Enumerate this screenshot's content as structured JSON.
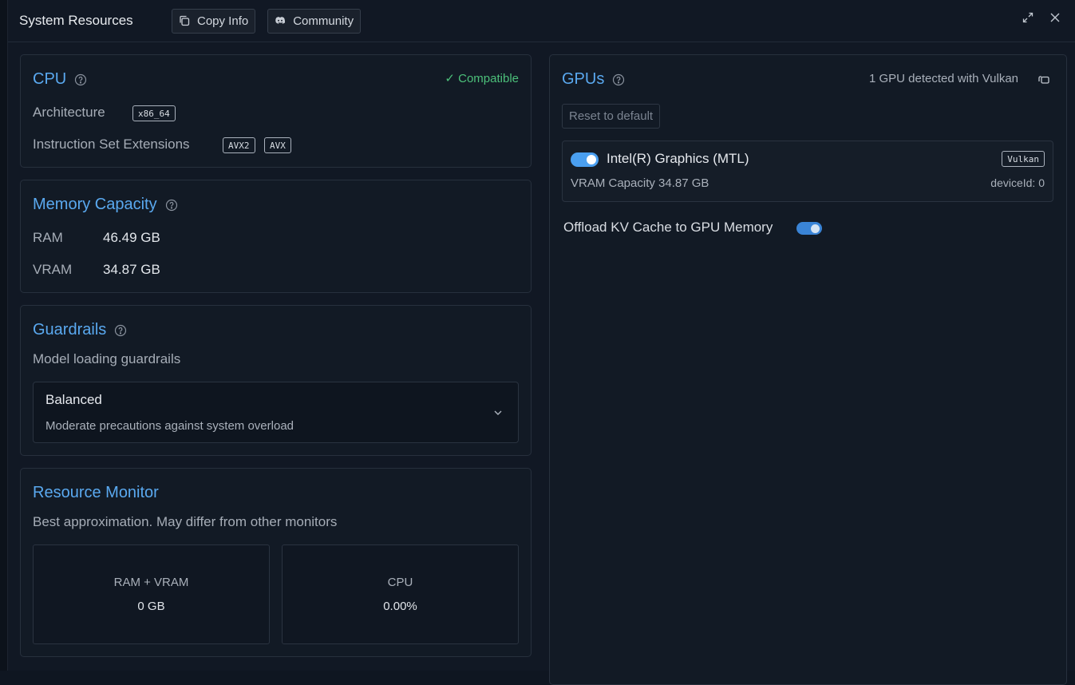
{
  "window": {
    "title": "System Resources",
    "copy_info_label": "Copy Info",
    "community_label": "Community"
  },
  "cpu": {
    "title": "CPU",
    "status": "✓ Compatible",
    "architecture_label": "Architecture",
    "architecture_value": "x86_64",
    "extensions_label": "Instruction Set Extensions",
    "extensions": [
      "AVX2",
      "AVX"
    ]
  },
  "memory": {
    "title": "Memory Capacity",
    "ram_label": "RAM",
    "ram_value": "46.49 GB",
    "vram_label": "VRAM",
    "vram_value": "34.87 GB"
  },
  "guardrails": {
    "title": "Guardrails",
    "subtitle": "Model loading guardrails",
    "selected": "Balanced",
    "selected_desc": "Moderate precautions against system overload"
  },
  "monitor": {
    "title": "Resource Monitor",
    "subtitle": "Best approximation. May differ from other monitors",
    "ram_vram_label": "RAM + VRAM",
    "ram_vram_value": "0 GB",
    "cpu_label": "CPU",
    "cpu_value": "0.00%"
  },
  "gpus": {
    "title": "GPUs",
    "detected_text": "1 GPU detected with Vulkan",
    "reset_label": "Reset to default",
    "device": {
      "name": "Intel(R) Graphics (MTL)",
      "backend": "Vulkan",
      "vram_text": "VRAM Capacity 34.87 GB",
      "device_id_text": "deviceId: 0",
      "enabled": true
    },
    "offload_label": "Offload KV Cache to GPU Memory",
    "offload_enabled": true
  },
  "colors": {
    "accent": "#5aa9f0",
    "success": "#4cc07a",
    "toggle_on": "#4a9ff0"
  }
}
